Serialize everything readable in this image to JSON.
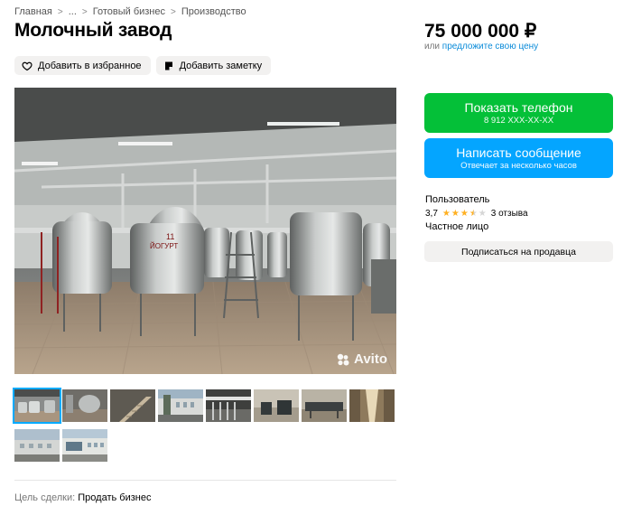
{
  "breadcrumb": {
    "items": [
      "Главная",
      "...",
      "Готовый бизнес",
      "Производство"
    ],
    "separator": ">"
  },
  "listing": {
    "title": "Молочный завод",
    "price": "75 000 000 ₽",
    "price_prefix": "или",
    "price_link": "предложите свою цену"
  },
  "actions": {
    "favorite_label": "Добавить в избранное",
    "note_label": "Добавить заметку"
  },
  "gallery": {
    "watermark": "Avito",
    "tank_label": "ЙОГУРТ",
    "tank_number": "11",
    "thumbnail_count": 10,
    "active_index": 0
  },
  "contact": {
    "phone_button": "Показать телефон",
    "phone_masked": "8 912 XXX-XX-XX",
    "message_button": "Написать сообщение",
    "message_sub": "Отвечает за несколько часов"
  },
  "seller": {
    "name": "Пользователь",
    "rating": "3,7",
    "rating_value": 3.7,
    "rating_max": 5,
    "reviews": "3 отзыва",
    "type": "Частное лицо",
    "subscribe_button": "Подписаться на продавца"
  },
  "details": {
    "deal_label": "Цель сделки:",
    "deal_value": "Продать бизнес"
  },
  "colors": {
    "phone_button": "#04c038",
    "message_button": "#04a5ff",
    "link": "#0a8bd9",
    "star": "#ffb021"
  },
  "icons": {
    "favorite": "heart-outline-icon",
    "note": "note-icon",
    "watermark": "avito-logo-icon"
  }
}
